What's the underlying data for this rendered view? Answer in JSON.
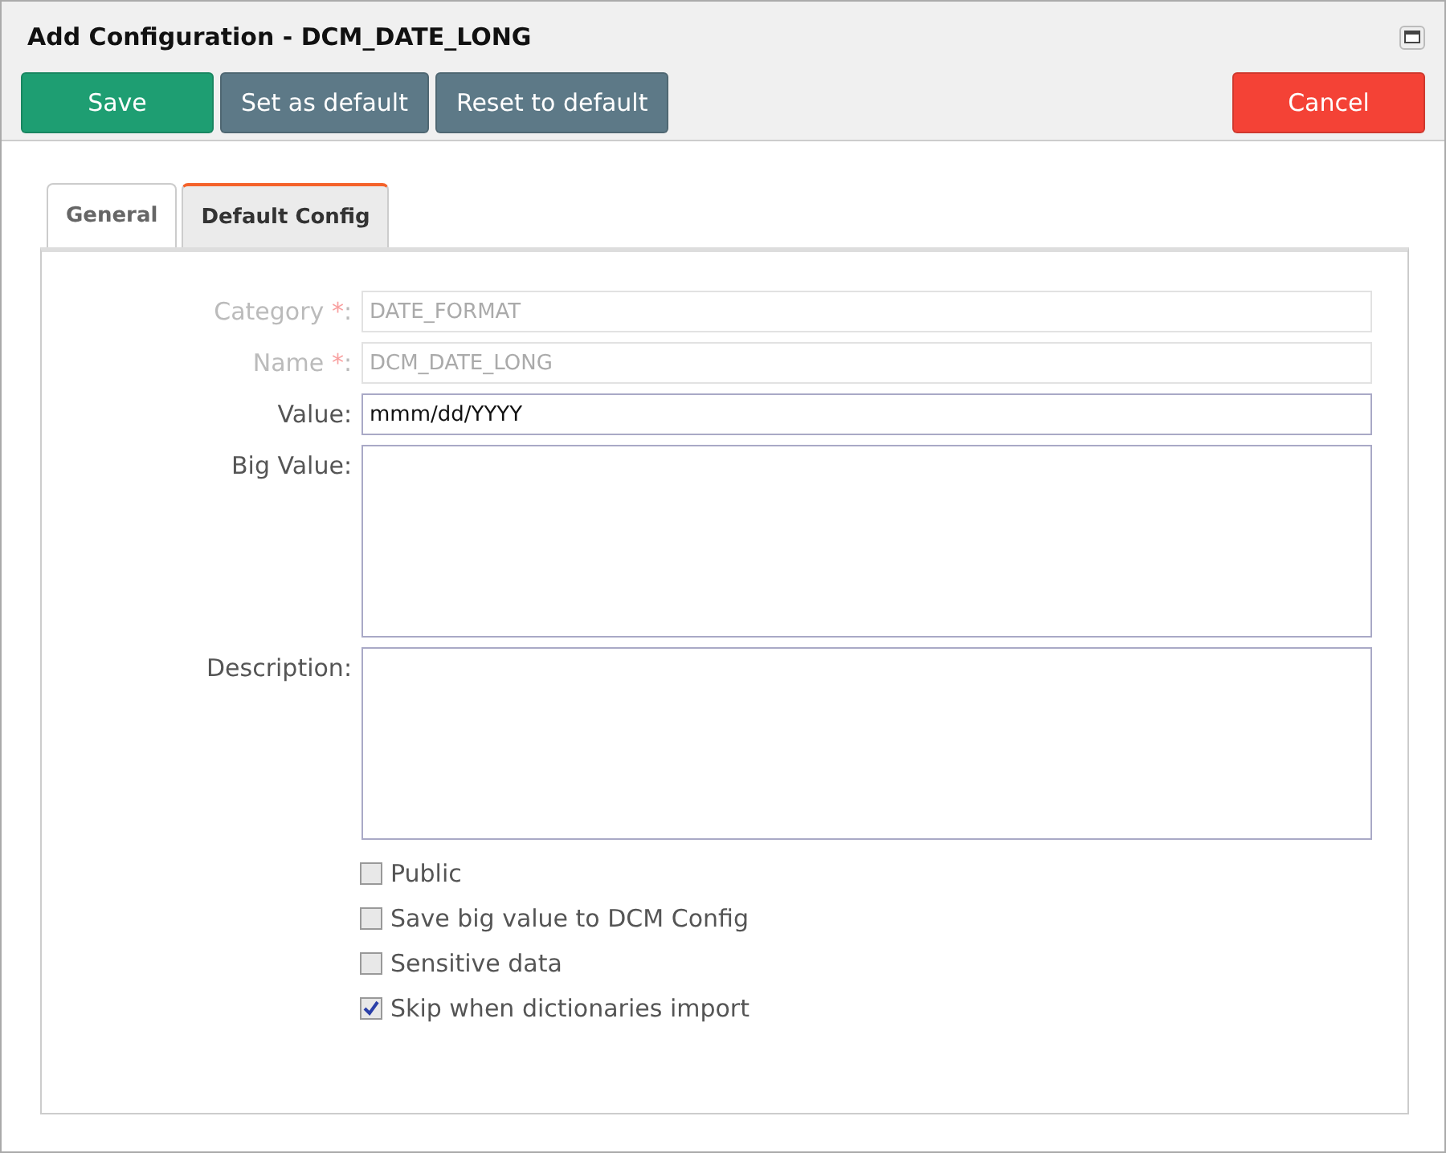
{
  "window": {
    "title": "Add Configuration - DCM_DATE_LONG"
  },
  "toolbar": {
    "buttons": [
      {
        "label": "Save",
        "kind": "primary"
      },
      {
        "label": "Set as default",
        "kind": "secondary"
      },
      {
        "label": "Reset to default",
        "kind": "secondary"
      }
    ],
    "cancel": {
      "label": "Cancel",
      "kind": "danger"
    }
  },
  "tabs": [
    {
      "label": "General",
      "selected": false
    },
    {
      "label": "Default Config",
      "selected": true
    }
  ],
  "fields": [
    {
      "label": "Category",
      "required_mark": "*",
      "suffix": ":",
      "kind": "input",
      "value": "DATE_FORMAT",
      "disabled": true
    },
    {
      "label": "Name",
      "required_mark": "*",
      "suffix": ":",
      "kind": "input",
      "value": "DCM_DATE_LONG",
      "disabled": true
    },
    {
      "label": "Value",
      "suffix": ":",
      "kind": "input",
      "value": "mmm/dd/YYYY",
      "disabled": false
    },
    {
      "label": "Big Value",
      "suffix": ":",
      "kind": "textarea"
    },
    {
      "label": "Description",
      "suffix": ":",
      "kind": "textarea"
    }
  ],
  "checkboxes": [
    {
      "label": "Public",
      "checked": false
    },
    {
      "label": "Save big value to DCM Config",
      "checked": false
    },
    {
      "label": "Sensitive data",
      "checked": false
    },
    {
      "label": "Skip when dictionaries import",
      "checked": true
    }
  ]
}
